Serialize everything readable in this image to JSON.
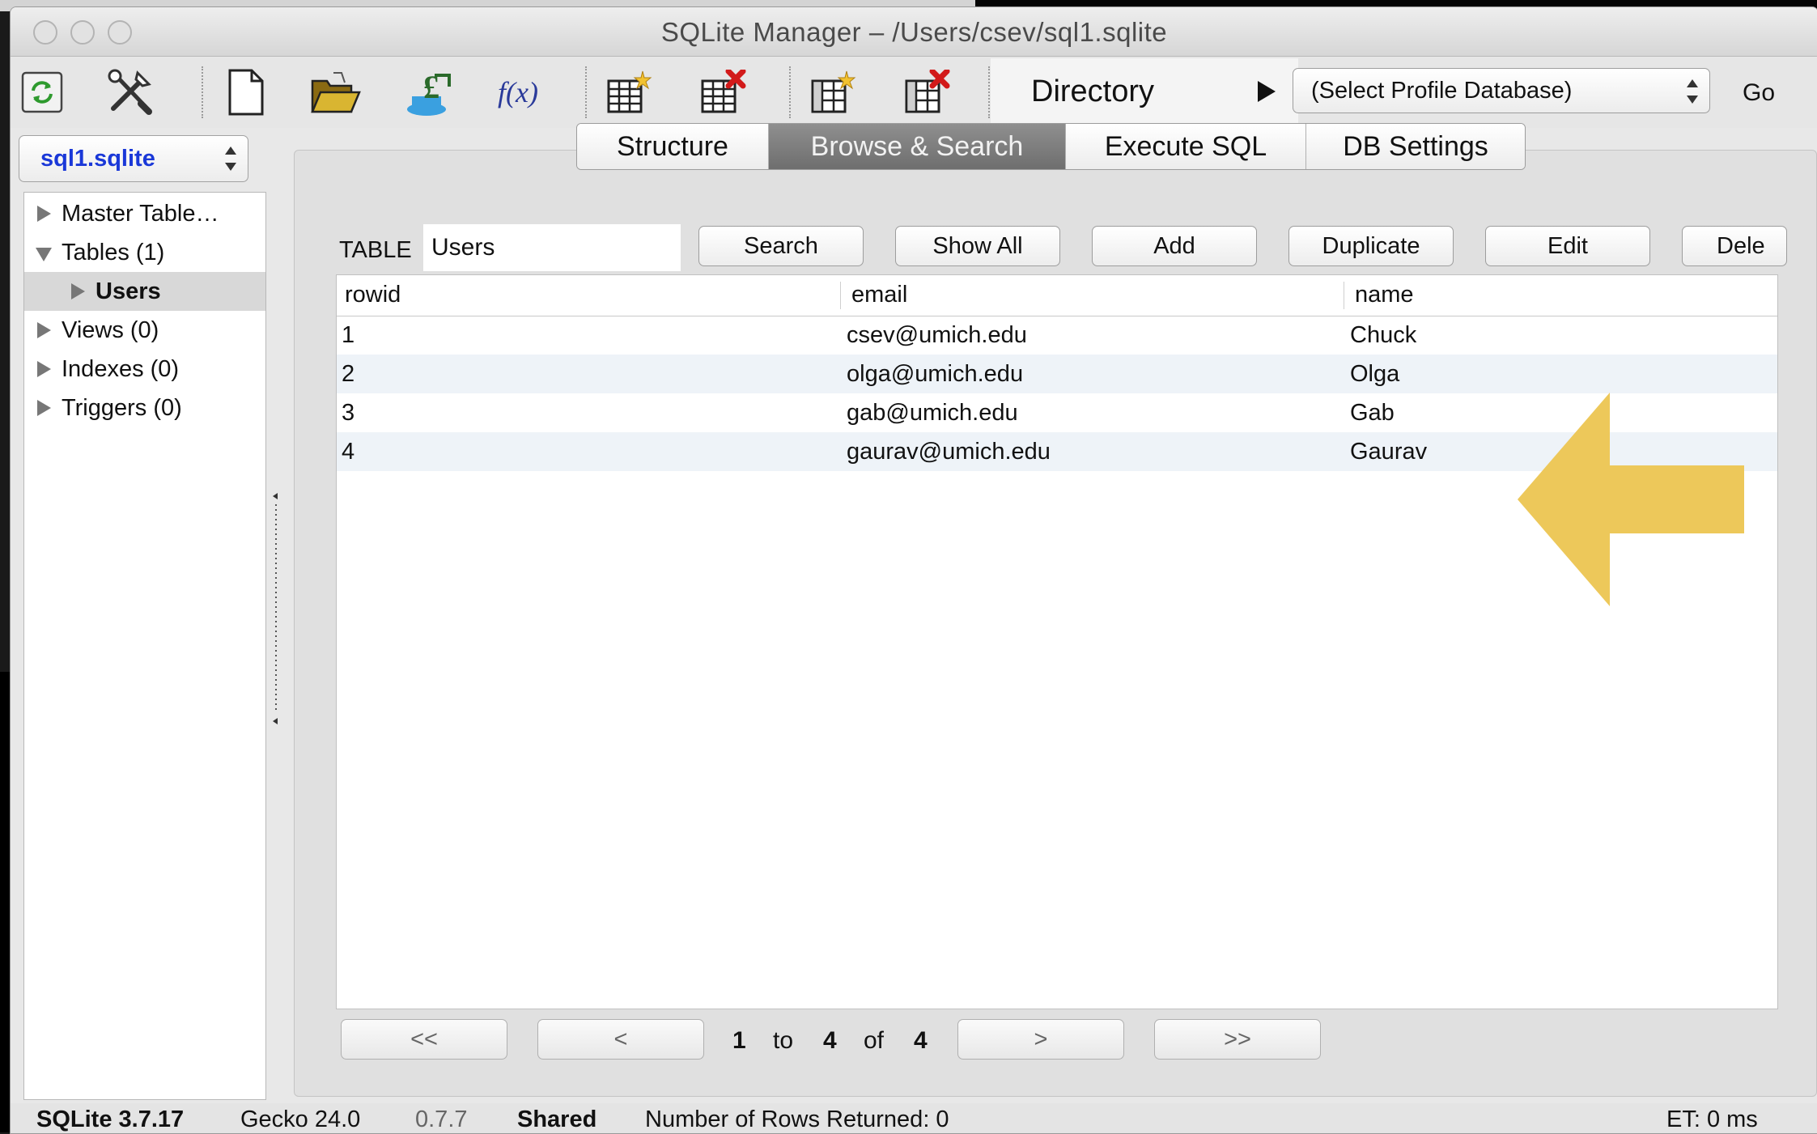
{
  "window": {
    "title": "SQLite Manager – /Users/csev/sql1.sqlite"
  },
  "toolbar": {
    "icons": [
      "refresh-icon",
      "settings-tools-icon",
      "new-database-icon",
      "open-database-icon",
      "export-icon",
      "function-icon",
      "create-table-icon",
      "drop-table-icon",
      "create-index-icon",
      "drop-index-icon"
    ],
    "function_label": "f(x)",
    "directory_label": "Directory",
    "profile_select": "(Select Profile Database)",
    "go_label": "Go"
  },
  "sidebar": {
    "db_select": "sql1.sqlite",
    "items": [
      {
        "label": "Master Table…"
      },
      {
        "label": "Tables (1)"
      },
      {
        "label": "Users"
      },
      {
        "label": "Views (0)"
      },
      {
        "label": "Indexes (0)"
      },
      {
        "label": "Triggers (0)"
      }
    ]
  },
  "tabs": [
    {
      "label": "Structure"
    },
    {
      "label": "Browse & Search"
    },
    {
      "label": "Execute SQL"
    },
    {
      "label": "DB Settings"
    }
  ],
  "browse": {
    "table_label": "TABLE",
    "table_value": "Users",
    "buttons": {
      "search": "Search",
      "show_all": "Show All",
      "add": "Add",
      "duplicate": "Duplicate",
      "edit": "Edit",
      "delete": "Dele"
    },
    "columns": [
      "rowid",
      "email",
      "name"
    ],
    "rows": [
      [
        "1",
        "csev@umich.edu",
        "Chuck"
      ],
      [
        "2",
        "olga@umich.edu",
        "Olga"
      ],
      [
        "3",
        "gab@umich.edu",
        "Gab"
      ],
      [
        "4",
        "gaurav@umich.edu",
        "Gaurav"
      ]
    ],
    "arrow_color": "#ecc653"
  },
  "pagination": {
    "first": "<<",
    "prev": "<",
    "next": ">",
    "last": ">>",
    "from": "1",
    "to_label": "to",
    "to": "4",
    "of_label": "of",
    "total": "4"
  },
  "status": {
    "sqlite": "SQLite 3.7.17",
    "gecko": "Gecko 24.0",
    "version": "0.7.7",
    "shared": "Shared",
    "rows_returned": "Number of Rows Returned: 0",
    "et": "ET: 0 ms"
  }
}
